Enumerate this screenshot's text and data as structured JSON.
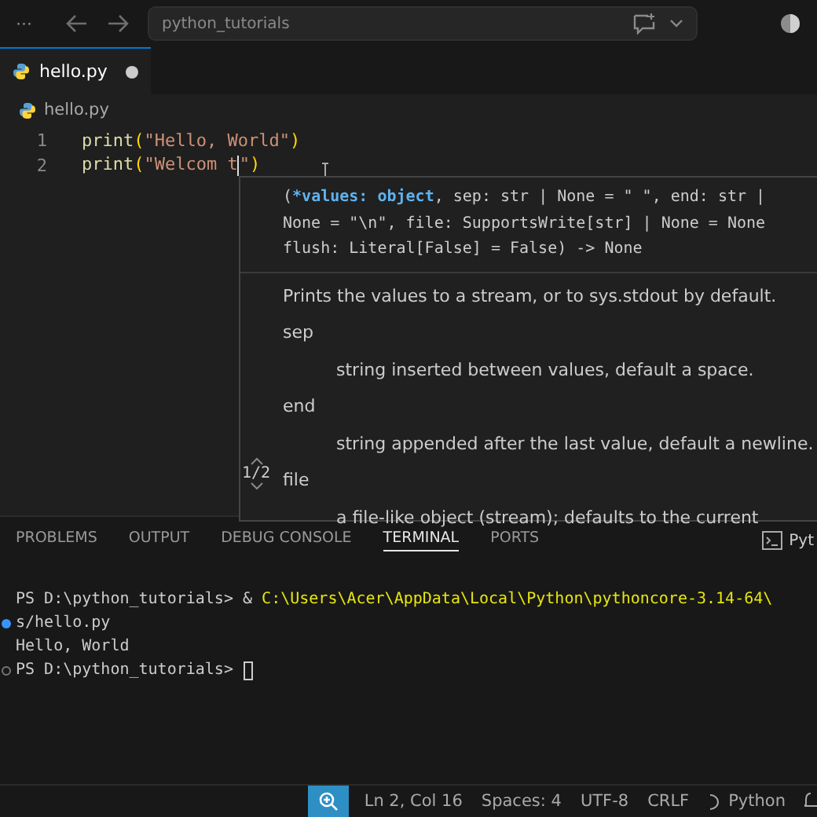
{
  "title_bar": {
    "menu": "···",
    "search": "python_tutorials"
  },
  "tabs": [
    {
      "label": "hello.py",
      "selected": true,
      "modified": true
    }
  ],
  "breadcrumb": "hello.py",
  "editor": {
    "lines": [
      {
        "number": "1",
        "tokens": [
          {
            "text": "print",
            "kind": "function"
          },
          {
            "text": "(",
            "kind": "bracket"
          },
          {
            "text": "\"Hello, World\"",
            "kind": "string"
          },
          {
            "text": ")",
            "kind": "bracket"
          }
        ]
      },
      {
        "number": "2",
        "tokens": [
          {
            "text": "print",
            "kind": "function"
          },
          {
            "text": "(",
            "kind": "bracket"
          },
          {
            "text": "\"Welcom t",
            "kind": "string"
          },
          {
            "kind": "cursor"
          },
          {
            "text": "\"",
            "kind": "string"
          },
          {
            "text": ")",
            "kind": "bracket"
          }
        ]
      }
    ]
  },
  "hover": {
    "pager": "1/2",
    "signature": [
      [
        {
          "text": "(",
          "highlight": false
        },
        {
          "text": "*values: object",
          "highlight": true
        },
        {
          "text": ", sep: str | None = \" \", end: str |",
          "highlight": false
        }
      ],
      [
        {
          "text": "None = \"\\n\", file: SupportsWrite[str] | None = None",
          "highlight": false
        }
      ],
      [
        {
          "text": "flush: Literal[False] = False) -> None",
          "highlight": false
        }
      ]
    ],
    "doc": [
      {
        "kind": "text",
        "text": "Prints the values to a stream, or to sys.stdout by default."
      },
      {
        "kind": "param",
        "text": "sep"
      },
      {
        "kind": "detail",
        "text": "string inserted between values, default a space."
      },
      {
        "kind": "param",
        "text": "end"
      },
      {
        "kind": "detail",
        "text": "string appended after the last value, default a newline."
      },
      {
        "kind": "param",
        "text": "file"
      },
      {
        "kind": "detail",
        "text": "a file-like object (stream); defaults to the current"
      }
    ]
  },
  "panel": {
    "tabs": [
      {
        "label": "PROBLEMS",
        "selected": false
      },
      {
        "label": "OUTPUT",
        "selected": false
      },
      {
        "label": "DEBUG CONSOLE",
        "selected": false
      },
      {
        "label": "TERMINAL",
        "selected": true
      },
      {
        "label": "PORTS",
        "selected": false
      }
    ],
    "terminal_name": "Pyt",
    "terminal": [
      {
        "kind": "output",
        "segments": [
          {
            "text": "PS D:\\python_tutorials> & ",
            "kind": "plain"
          },
          {
            "text": "C:\\Users\\Acer\\AppData\\Local\\Python\\pythoncore-3.14-64\\",
            "kind": "path"
          }
        ]
      },
      {
        "kind": "command_success",
        "segments": [
          {
            "text": "s/hello.py",
            "kind": "plain"
          }
        ]
      },
      {
        "kind": "output",
        "segments": [
          {
            "text": "Hello, World",
            "kind": "plain"
          }
        ]
      },
      {
        "kind": "command_pending",
        "segments": [
          {
            "text": "PS D:\\python_tutorials> ",
            "kind": "plain"
          }
        ],
        "cursor": true
      }
    ]
  },
  "status_bar": {
    "items": [
      "Ln 2, Col 16",
      "Spaces: 4",
      "UTF-8",
      "CRLF"
    ],
    "language": "Python"
  }
}
